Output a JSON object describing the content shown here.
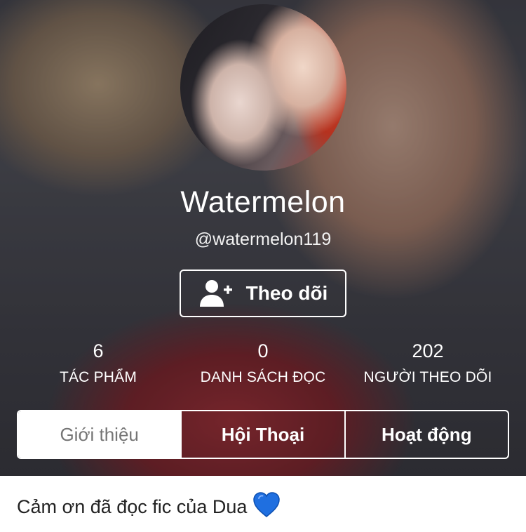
{
  "profile": {
    "display_name": "Watermelon",
    "username": "@watermelon119",
    "follow_label": "Theo dõi"
  },
  "stats": [
    {
      "value": "6",
      "label": "TÁC PHẨM"
    },
    {
      "value": "0",
      "label": "DANH SÁCH ĐỌC"
    },
    {
      "value": "202",
      "label": "NGƯỜI THEO DÕI"
    }
  ],
  "tabs": [
    {
      "label": "Giới thiệu",
      "active": true
    },
    {
      "label": "Hội Thoại",
      "active": false
    },
    {
      "label": "Hoạt động",
      "active": false
    }
  ],
  "about": {
    "text": "Cảm ơn đã đọc fic của Dua",
    "emoji_icon": "blue-heart-icon"
  },
  "colors": {
    "tab_active_bg": "#ffffff",
    "tab_active_text": "#757575",
    "heart": "#1f6fe0"
  }
}
